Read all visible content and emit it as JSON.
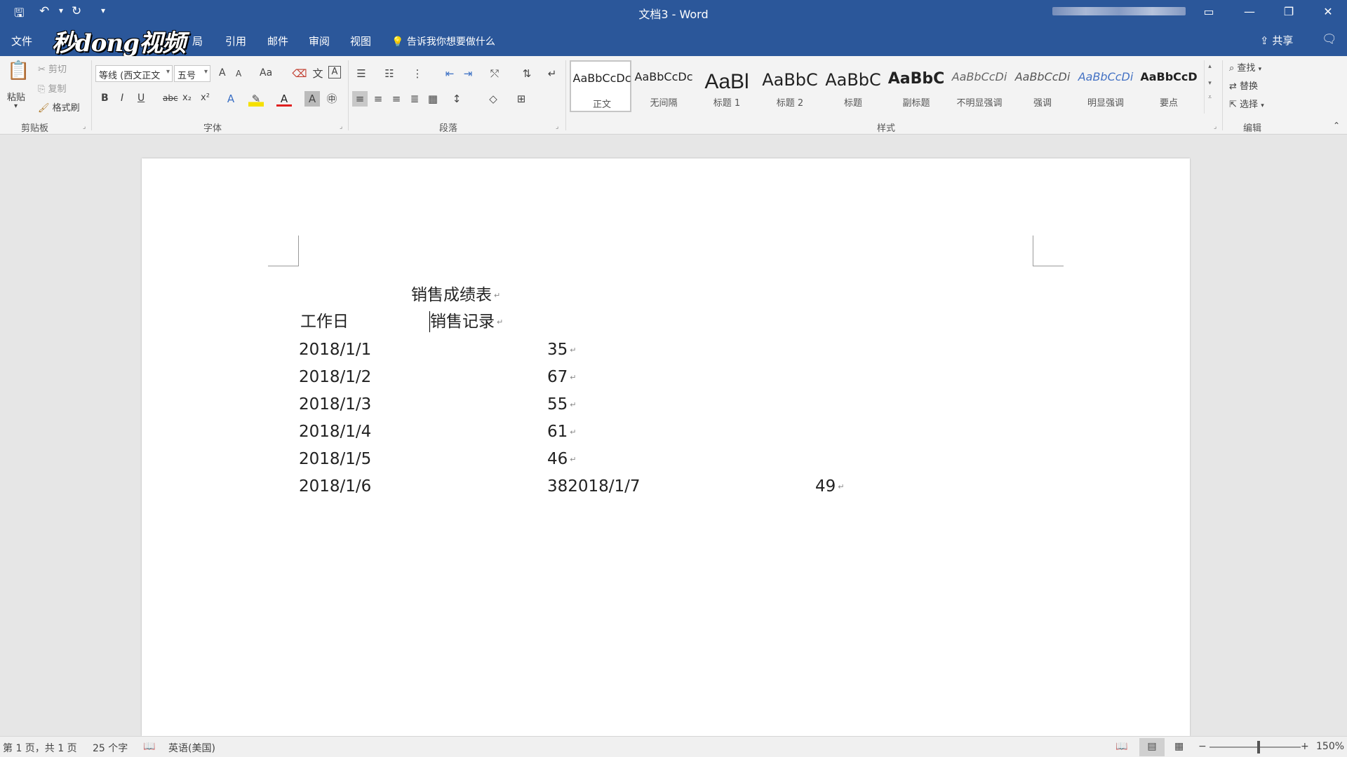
{
  "window": {
    "title": "文档3  -  Word",
    "watermark_text": "秒dong视频"
  },
  "tabs": {
    "file": "文件",
    "layout_partial": "局",
    "references": "引用",
    "mailings": "邮件",
    "review": "审阅",
    "view": "视图",
    "tell_me": "告诉我你想要做什么",
    "share": "共享"
  },
  "clipboard": {
    "paste": "粘贴",
    "cut": "剪切",
    "copy": "复制",
    "format_painter": "格式刷",
    "label": "剪贴板"
  },
  "font": {
    "name": "等线 (西文正文",
    "size": "五号",
    "bold": "B",
    "italic": "I",
    "underline": "U",
    "strike": "abc",
    "sub": "x₂",
    "sup": "x²",
    "grow": "A",
    "shrink": "A",
    "case": "Aa",
    "label": "字体"
  },
  "paragraph": {
    "label": "段落"
  },
  "styles": {
    "label": "样式",
    "items": [
      {
        "sample": "AaBbCcDc",
        "name": "正文"
      },
      {
        "sample": "AaBbCcDc",
        "name": "无间隔"
      },
      {
        "sample": "AaBl",
        "name": "标题 1"
      },
      {
        "sample": "AaBbC",
        "name": "标题 2"
      },
      {
        "sample": "AaBbC",
        "name": "标题"
      },
      {
        "sample": "AaBbC",
        "name": "副标题"
      },
      {
        "sample": "AaBbCcDi",
        "name": "不明显强调"
      },
      {
        "sample": "AaBbCcDi",
        "name": "强调"
      },
      {
        "sample": "AaBbCcDi",
        "name": "明显强调"
      },
      {
        "sample": "AaBbCcD",
        "name": "要点"
      }
    ]
  },
  "editing": {
    "find": "查找",
    "replace": "替换",
    "select": "选择",
    "label": "编辑"
  },
  "document": {
    "title": "销售成绩表",
    "header_day": "工作日",
    "header_record": "销售记录",
    "rows": [
      {
        "date": "2018/1/1",
        "value": "35"
      },
      {
        "date": "2018/1/2",
        "value": "67"
      },
      {
        "date": "2018/1/3",
        "value": "55"
      },
      {
        "date": "2018/1/4",
        "value": "61"
      },
      {
        "date": "2018/1/5",
        "value": "46"
      }
    ],
    "last_row": {
      "date": "2018/1/6",
      "value_run": "382018/1/7",
      "value_tail": "49"
    },
    "para_mark": "↵"
  },
  "status": {
    "page": "第 1 页，共 1 页",
    "words": "25 个字",
    "language": "英语(美国)",
    "zoom": "150%"
  }
}
